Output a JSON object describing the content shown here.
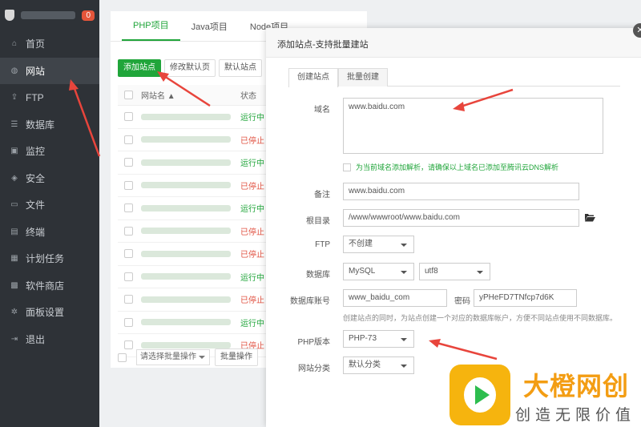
{
  "sidebar": {
    "badge": "0",
    "items": [
      {
        "label": "首页",
        "icon": "home-icon",
        "glyph": "⌂"
      },
      {
        "label": "网站",
        "icon": "globe-icon",
        "glyph": "◍"
      },
      {
        "label": "FTP",
        "icon": "ftp-icon",
        "glyph": "⇪"
      },
      {
        "label": "数据库",
        "icon": "database-icon",
        "glyph": "☰"
      },
      {
        "label": "监控",
        "icon": "monitor-icon",
        "glyph": "▣"
      },
      {
        "label": "安全",
        "icon": "shield-icon",
        "glyph": "◈"
      },
      {
        "label": "文件",
        "icon": "folder-icon",
        "glyph": "▭"
      },
      {
        "label": "终端",
        "icon": "terminal-icon",
        "glyph": "▤"
      },
      {
        "label": "计划任务",
        "icon": "calendar-icon",
        "glyph": "▦"
      },
      {
        "label": "软件商店",
        "icon": "grid-icon",
        "glyph": "▩"
      },
      {
        "label": "面板设置",
        "icon": "gear-icon",
        "glyph": "✲"
      },
      {
        "label": "退出",
        "icon": "logout-icon",
        "glyph": "⇥"
      }
    ]
  },
  "main": {
    "tabs": [
      "PHP项目",
      "Java项目",
      "Node项目"
    ],
    "toolbar": {
      "add_site": "添加站点",
      "edit_default": "修改默认页",
      "default_site": "默认站点"
    },
    "table": {
      "headers": {
        "name": "网站名 ▲",
        "status": "状态"
      },
      "statuses": [
        "运行中",
        "已停止",
        "运行中",
        "已停止",
        "运行中",
        "已停止",
        "已停止",
        "运行中",
        "已停止",
        "运行中",
        "已停止"
      ]
    },
    "bulk_select": "请选择批量操作",
    "bulk_button": "批量操作"
  },
  "modal": {
    "title": "添加站点-支持批量建站",
    "tabs": [
      "创建站点",
      "批量创建"
    ],
    "domain_label": "域名",
    "domain_value": "www.baidu.com",
    "dns_hint": "为当前域名添加解析，请确保以上域名已添加至腾讯云DNS解析",
    "remark_label": "备注",
    "remark_value": "www.baidu.com",
    "root_label": "根目录",
    "root_value": "/www/wwwroot/www.baidu.com",
    "ftp_label": "FTP",
    "ftp_value": "不创建",
    "db_label": "数据库",
    "db_value": "MySQL",
    "charset_value": "utf8",
    "db_account_label": "数据库账号",
    "db_account_value": "www_baidu_com",
    "password_label": "密码",
    "password_value": "yPHeFD7TNfcp7d6K",
    "db_hint": "创建站点的同时，为站点创建一个对应的数据库帐户，方便不同站点使用不同数据库。",
    "php_label": "PHP版本",
    "php_value": "PHP-73",
    "category_label": "网站分类",
    "category_value": "默认分类",
    "close_glyph": "✕"
  },
  "watermark": {
    "title": "大橙网创",
    "subtitle": "创造无限价值"
  },
  "colors": {
    "accent": "#20a53a",
    "running": "#20a53a",
    "stopped": "#e05140",
    "arrow": "#e8453c",
    "sidebar_bg": "#2e3237"
  }
}
